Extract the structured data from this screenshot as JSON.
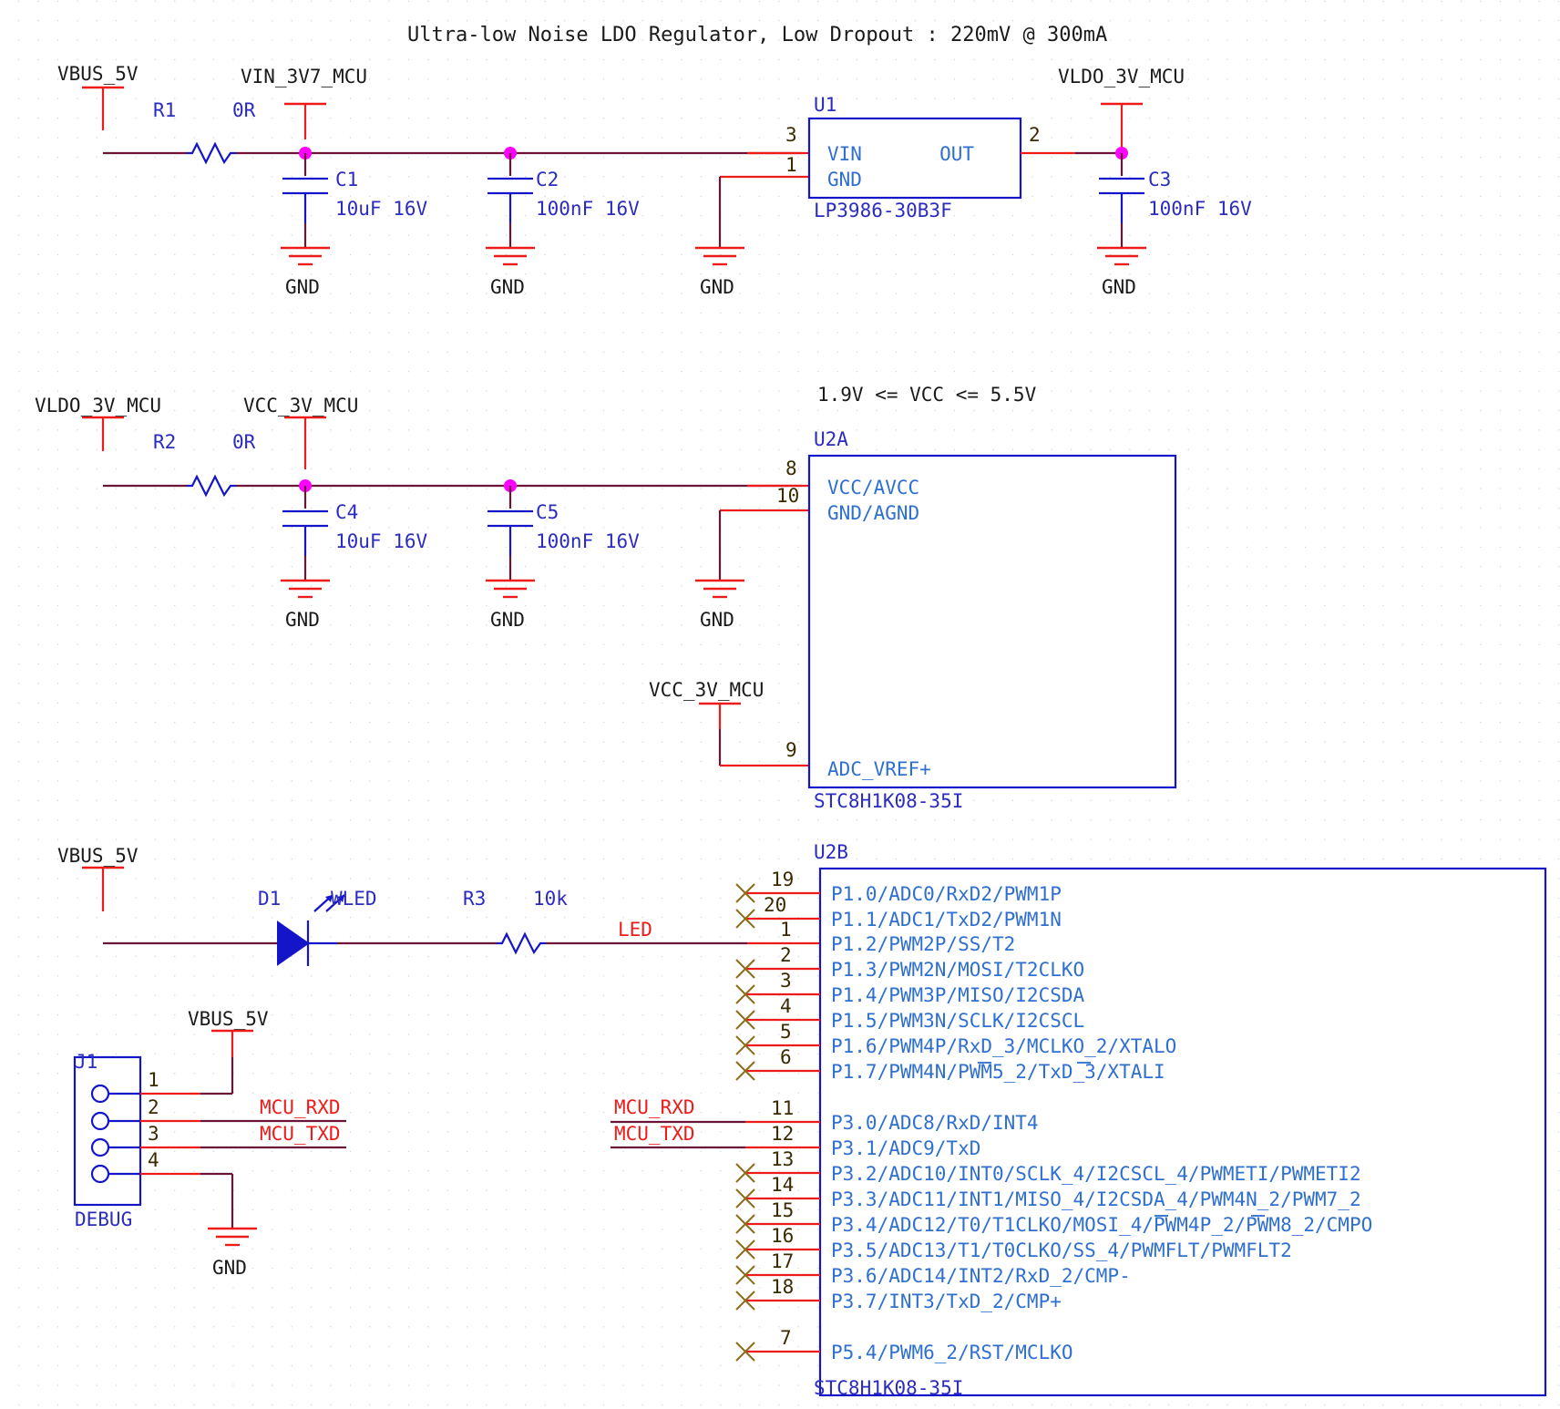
{
  "sheet": {
    "title_note": "Ultra-low Noise LDO Regulator, Low Dropout : 220mV @ 300mA",
    "vcc_note": "1.9V <= VCC <= 5.5V",
    "gnd_label": "GND"
  },
  "section1": {
    "nets": {
      "vbus": "VBUS_5V",
      "vin": "VIN_3V7_MCU",
      "vldo": "VLDO_3V_MCU"
    },
    "r1": {
      "ref": "R1",
      "value": "0R"
    },
    "c1": {
      "ref": "C1",
      "value": "10uF 16V"
    },
    "c2": {
      "ref": "C2",
      "value": "100nF 16V"
    },
    "c3": {
      "ref": "C3",
      "value": "100nF 16V"
    },
    "u1": {
      "ref": "U1",
      "part": "LP3986-30B3F",
      "pins": [
        {
          "num": "3",
          "name": "VIN"
        },
        {
          "num": "1",
          "name": "GND"
        },
        {
          "num": "2",
          "name": "OUT"
        }
      ]
    },
    "grounds": [
      "GND",
      "GND",
      "GND",
      "GND"
    ]
  },
  "section2": {
    "nets": {
      "vldo": "VLDO_3V_MCU",
      "vcc": "VCC_3V_MCU",
      "vref_net": "VCC_3V_MCU"
    },
    "r2": {
      "ref": "R2",
      "value": "0R"
    },
    "c4": {
      "ref": "C4",
      "value": "10uF 16V"
    },
    "c5": {
      "ref": "C5",
      "value": "100nF 16V"
    },
    "u2a": {
      "ref": "U2A",
      "part": "STC8H1K08-35I",
      "pins": [
        {
          "num": "8",
          "name": "VCC/AVCC"
        },
        {
          "num": "10",
          "name": "GND/AGND"
        },
        {
          "num": "9",
          "name": "ADC_VREF+"
        }
      ]
    },
    "grounds": [
      "GND",
      "GND",
      "GND"
    ]
  },
  "section3": {
    "nets": {
      "vbus_led": "VBUS_5V",
      "led": "LED",
      "vbus_j1": "VBUS_5V",
      "mcu_rxd_j1": "MCU_RXD",
      "mcu_txd_j1": "MCU_TXD",
      "mcu_rxd_u2b": "MCU_RXD",
      "mcu_txd_u2b": "MCU_TXD"
    },
    "d1": {
      "ref": "D1",
      "value": "WLED"
    },
    "r3": {
      "ref": "R3",
      "value": "10k"
    },
    "j1": {
      "ref": "J1",
      "part": "DEBUG",
      "pins": [
        "1",
        "2",
        "3",
        "4"
      ]
    },
    "gnd_label": "GND",
    "u2b": {
      "ref": "U2B",
      "part": "STC8H1K08-35I",
      "pins": [
        {
          "num": "19",
          "name": "P1.0/ADC0/RxD2/PWM1P",
          "nc": true
        },
        {
          "num": "20",
          "name": "P1.1/ADC1/TxD2/PWM1N",
          "nc": true
        },
        {
          "num": "1",
          "name": "P1.2/PWM2P/SS/T2",
          "nc": false
        },
        {
          "num": "2",
          "name": "P1.3/PWM2N/MOSI/T2CLKO",
          "nc": true
        },
        {
          "num": "3",
          "name": "P1.4/PWM3P/MISO/I2CSDA",
          "nc": true
        },
        {
          "num": "4",
          "name": "P1.5/PWM3N/SCLK/I2CSCL",
          "nc": true
        },
        {
          "num": "5",
          "name": "P1.6/PWM4P/RxD_3/MCLKO_2/XTALO",
          "nc": true
        },
        {
          "num": "6",
          "name": "P1.7/PWM4N/PWM5_2/TxD_3/XTALI",
          "nc": true
        },
        {
          "num": "11",
          "name": "P3.0/ADC8/RxD/INT4",
          "nc": false
        },
        {
          "num": "12",
          "name": "P3.1/ADC9/TxD",
          "nc": false
        },
        {
          "num": "13",
          "name": "P3.2/ADC10/INT0/SCLK_4/I2CSCL_4/PWMETI/PWMETI2",
          "nc": true
        },
        {
          "num": "14",
          "name": "P3.3/ADC11/INT1/MISO_4/I2CSDA_4/PWM4N_2/PWM7_2",
          "nc": true
        },
        {
          "num": "15",
          "name": "P3.4/ADC12/T0/T1CLKO/MOSI_4/PWM4P_2/PWM8_2/CMPO",
          "nc": true
        },
        {
          "num": "16",
          "name": "P3.5/ADC13/T1/T0CLKO/SS_4/PWMFLT/PWMFLT2",
          "nc": true
        },
        {
          "num": "17",
          "name": "P3.6/ADC14/INT2/RxD_2/CMP-",
          "nc": true
        },
        {
          "num": "18",
          "name": "P3.7/INT3/TxD_2/CMP+",
          "nc": true
        },
        {
          "num": "7",
          "name": "P5.4/PWM6_2/RST/MCLKO",
          "nc": true
        }
      ]
    }
  },
  "colors": {
    "wire_dark": "#6b1438",
    "wire_red": "#ee1b1b",
    "component_blue": "#1414c8",
    "pin_name_blue": "#2f6fd0",
    "junction_magenta": "#ff00ff",
    "nc_olive": "#8a6d1a"
  }
}
